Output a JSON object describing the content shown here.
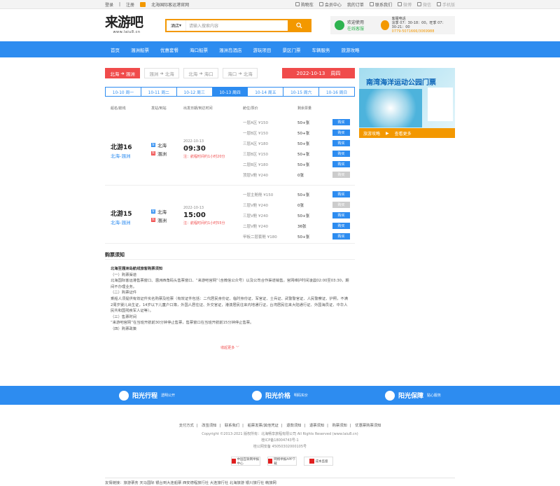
{
  "topbar": {
    "login": "登录",
    "sep": "|",
    "register": "注册",
    "site": "北海国际客运港官网",
    "cart": "购物车",
    "member": "会员中心",
    "orders": "我的订单",
    "feedback": "联系我们",
    "weibo": "微博",
    "wechat": "微信",
    "mobile": "手机版"
  },
  "header": {
    "logo": "来游吧",
    "logo_url": "www.laiu8.cn",
    "search_select": "酒店",
    "search_placeholder": "请输入搜索内容",
    "svc_wechat": "欢迎使用",
    "svc_wechat_status": "在线客服",
    "svc_phone_label": "客服电话",
    "svc_phone_hours": "淡季 07：30-18：00，旺季 07：30-21：00",
    "svc_phone": "0779-5071666/3069988"
  },
  "nav": [
    "首页",
    "涠洲船票",
    "优惠套餐",
    "海口船票",
    "涠洲岛酒店",
    "游玩项目",
    "景区门票",
    "车辆服务",
    "旅游攻略"
  ],
  "routes": [
    {
      "from": "北海",
      "to": "涠洲"
    },
    {
      "from": "涠洲",
      "to": "北海"
    },
    {
      "from": "北海",
      "to": "海口"
    },
    {
      "from": "海口",
      "to": "北海"
    }
  ],
  "date_badge": {
    "date": "2022-10-13",
    "weekday": "周四"
  },
  "days": [
    "10-10 周一",
    "10-11 周二",
    "10-12 周三",
    "10-13 周四",
    "10-14 周五",
    "10-15 周六",
    "10-16 周日"
  ],
  "table_head": {
    "ship": "船名/航线",
    "ports": "发站/到站",
    "depart": "出发日期/到达时间",
    "seat": "舱位/票价",
    "remain": "剩余票量"
  },
  "ships": [
    {
      "name": "北游16",
      "route": "北海-涠洲",
      "from_flag": "发",
      "from": "北海",
      "to_flag": "到",
      "to": "涠洲",
      "date": "2022-10-13",
      "time": "09:30",
      "note": "注：航程时间约1小时20分",
      "seats": [
        {
          "seat": "一层A区",
          "price": "¥150",
          "remain": "50+张",
          "btn": "购买"
        },
        {
          "seat": "一层B区",
          "price": "¥150",
          "remain": "50+张",
          "btn": "购买"
        },
        {
          "seat": "三层A区",
          "price": "¥180",
          "remain": "50+张",
          "btn": "购买"
        },
        {
          "seat": "三层B区",
          "price": "¥150",
          "remain": "50+张",
          "btn": "购买"
        },
        {
          "seat": "二层B区",
          "price": "¥180",
          "remain": "50+张",
          "btn": "购买"
        },
        {
          "seat": "顶层V舱",
          "price": "¥240",
          "remain": "0张",
          "btn": "购买"
        }
      ]
    },
    {
      "name": "北游15",
      "route": "北海-涠洲",
      "from_flag": "发",
      "from": "北海",
      "to_flag": "到",
      "to": "涠洲",
      "date": "2022-10-13",
      "time": "15:00",
      "note": "注：航程时间约1小时55分",
      "seats": [
        {
          "seat": "一层主舱舱",
          "price": "¥150",
          "remain": "50+张",
          "btn": "购买"
        },
        {
          "seat": "三层V舱",
          "price": "¥240",
          "remain": "0张",
          "btn": "购买"
        },
        {
          "seat": "三层V舱",
          "price": "¥240",
          "remain": "50+张",
          "btn": "购买"
        },
        {
          "seat": "二层V舱",
          "price": "¥240",
          "remain": "36张",
          "btn": "购买"
        },
        {
          "seat": "甲板二层套舱",
          "price": "¥180",
          "remain": "50+张",
          "btn": "购买"
        }
      ]
    }
  ],
  "notice": {
    "title": "购票须知",
    "heading": "北海至涠洲岛航线旅客购票须知",
    "lines": [
      "（一）购票渠道",
      "北海国际客运港售票窗口、涠洲西角码头售票窗口、“来游吧官网”（含微信公众号）以及公司合作渠道销售。官网维护时间凌晨02:00至03:30，期间不办理业务。",
      "（二）购票证件",
      "乘船人须提供有效证件实名购票及检票（有效证件包括：二代居民身份证、临时身份证、军官证、士兵证、武警警官证、人民警察证、护照，不满2周岁婴儿出生证，14岁以下儿童户口簿，外国人居住证、外交官证，港澳居民往来内地通行证，台湾居民往来大陆通行证、外国海员证、中华人民共和国残疾军人证等）。",
      "（三）售票时间",
      "“来游吧官网”在当班开航前30分钟停止售票，售票窗口在当班开航前15分钟停止售票。",
      "（四）购票政策"
    ],
    "more": "收起更多"
  },
  "ad": {
    "title": "南湾海洋运动公园门票",
    "bar1": "旅游攻略",
    "bar2": "查看更多"
  },
  "pledges": [
    {
      "b": "阳光行程",
      "s": "透明公开"
    },
    {
      "b": "阳光价格",
      "s": "明码实价"
    },
    {
      "b": "阳光保障",
      "s": "贴心服务"
    }
  ],
  "footer": {
    "links": [
      "支付方式",
      "改签须知",
      "联系我们",
      "船票发票/其他凭证",
      "退款须知",
      "退票须知",
      "购票须知",
      "优惠票购票须知"
    ],
    "copyright": "Copyright ©2013-2021  版权所有：北海畅享旅程有限公司  All Rights Reserved    (www.laiu8.cn)",
    "icp": "桂ICP备18004743号-1",
    "police": "桂公网安备 45050302000105号",
    "badges": [
      "中国互联网举报中心",
      "网络举报APP下载",
      "成本监督"
    ],
    "friends": "友情链接：旅游票务  天马国际  银台到大连船票  西安德程旅行社  大连旅行社  北海旅游  银川旅行社  韩旅网"
  }
}
